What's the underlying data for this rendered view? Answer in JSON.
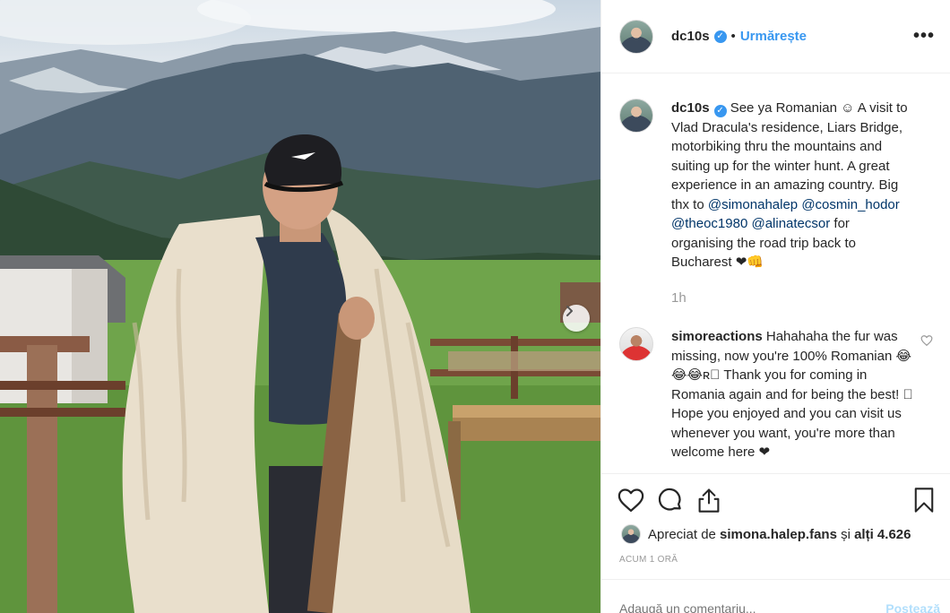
{
  "post": {
    "username": "dc10s",
    "verified_glyph": "✓",
    "separator": "•",
    "follow_label": "Urmărește",
    "more_label": "•••",
    "photo_alt": "photo"
  },
  "caption": {
    "username": "dc10s",
    "text_1": " See ya Romanian ☺ A visit to Vlad Dracula's residence, Liars Bridge, motorbiking thru the mountains and suiting up for the winter hunt. A great experience in an amazing country. Big thx to ",
    "mention_1": "@simonahalep",
    "mention_2": "@cosmin_hodor",
    "mention_3": "@theoc1980",
    "mention_4": "@alinatecsor",
    "text_2": " for organising the road trip back to Bucharest ❤👊",
    "time": "1h"
  },
  "comments": [
    {
      "username": "simoreactions",
      "text": " Hahahaha the fur was missing, now you're 100% Romanian 😂😂😂ʀ⃣ Thank you for coming in Romania again and for being the best! ⃣ Hope you enjoyed and you can visit us whenever you want, you're more than welcome here ❤"
    }
  ],
  "actions": {
    "like_icon": "heart-icon",
    "comment_icon": "comment-icon",
    "share_icon": "share-icon",
    "save_icon": "bookmark-icon"
  },
  "likes": {
    "prefix": "Apreciat de ",
    "user": "simona.halep.fans",
    "middle": " și ",
    "others": "alți 4.626"
  },
  "time_ago": "Acum 1 oră",
  "add_comment": {
    "placeholder": "Adaugă un comentariu...",
    "post_label": "Postează"
  },
  "colors": {
    "link": "#3897f0",
    "mention": "#003569",
    "muted": "#999999",
    "border": "#efefef"
  }
}
